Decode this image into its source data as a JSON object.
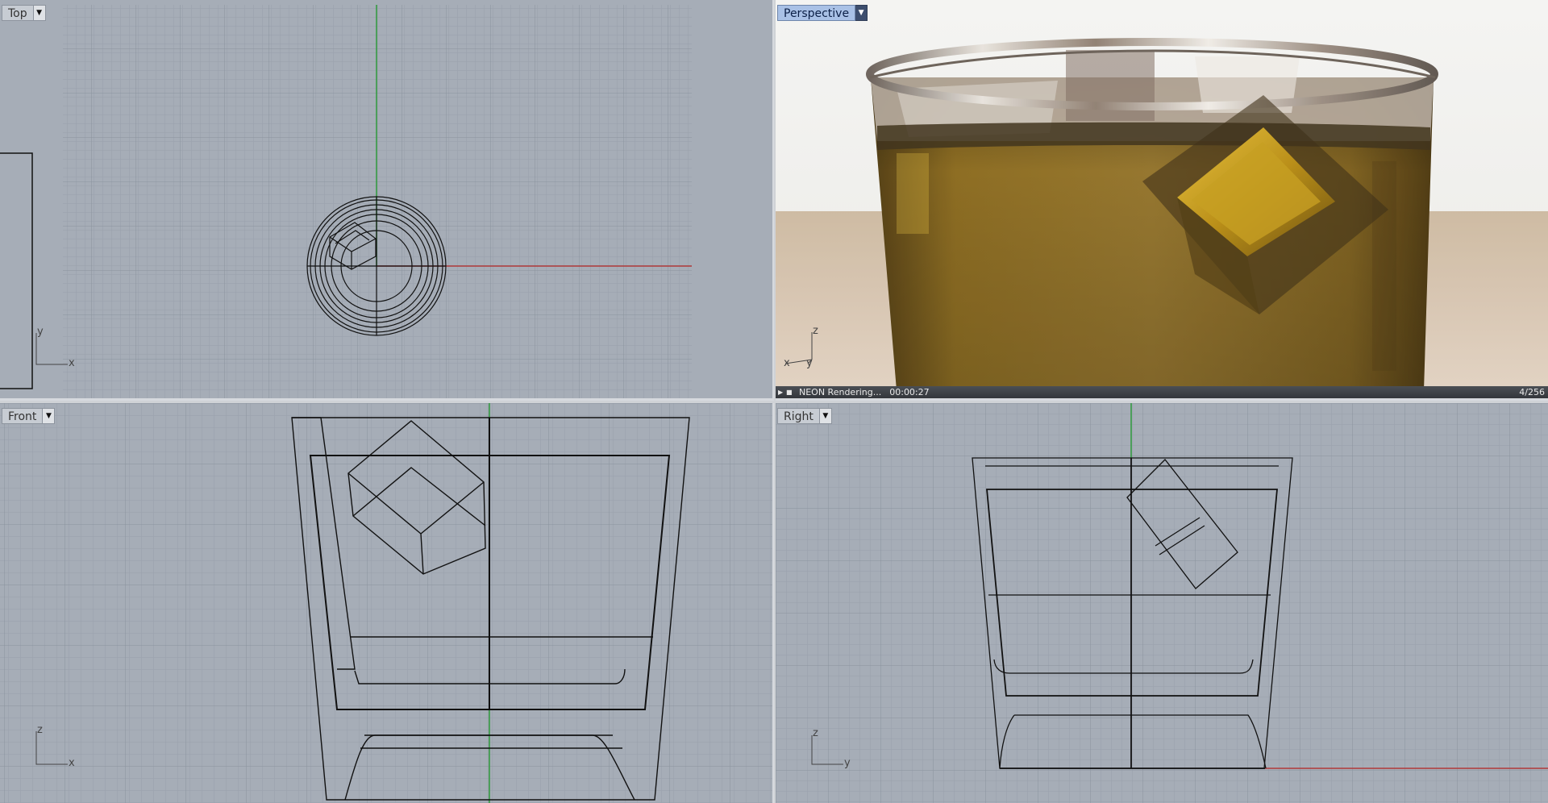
{
  "viewports": {
    "top": {
      "title": "Top",
      "axis_x": "x",
      "axis_y": "y"
    },
    "perspective": {
      "title": "Perspective",
      "axis_x": "x",
      "axis_y": "y",
      "axis_z": "z",
      "render_status": "NEON Rendering...",
      "render_time": "00:00:27",
      "render_passes": "4/256"
    },
    "front": {
      "title": "Front",
      "axis_x": "x",
      "axis_z": "z"
    },
    "right": {
      "title": "Right",
      "axis_y": "y",
      "axis_z": "z"
    }
  },
  "icons": {
    "dropdown": "triangle-down-icon",
    "play": "play-icon",
    "lock": "lock-icon"
  },
  "colors": {
    "viewport_bg": "#a6adb7",
    "grid_minor": "#98a0ab",
    "grid_major": "#8a929e",
    "axis_x": "#b03a3a",
    "axis_y": "#2f9a3c",
    "wire": "#111111",
    "active_tab": "#a9c1e6"
  }
}
